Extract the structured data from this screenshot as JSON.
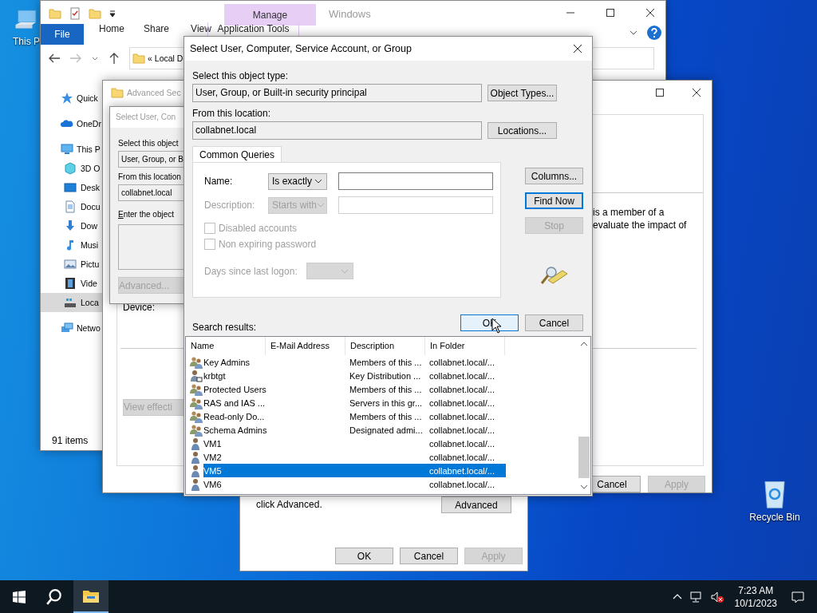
{
  "desktop_icons": [
    {
      "kind": "computer",
      "label": "This P"
    },
    {
      "kind": "recycle-bin",
      "label": "Recycle Bin"
    }
  ],
  "explorer": {
    "active": false,
    "title": "Windows",
    "context_tab": "Manage",
    "context_group": "Application Tools",
    "file_tab": "File",
    "ribbon_tabs": [
      "Home",
      "Share",
      "View"
    ],
    "address": {
      "prefix": "«",
      "path": "Local D"
    },
    "nav": [
      {
        "kind": "star",
        "label": "Quick",
        "selected": false
      },
      {
        "kind": "cloud",
        "label": "OneDr",
        "selected": false
      },
      {
        "kind": "pc",
        "label": "This P",
        "selected": false,
        "children": [
          {
            "kind": "cube",
            "label": "3D O",
            "selected": false
          },
          {
            "kind": "desktop",
            "label": "Desk",
            "selected": false
          },
          {
            "kind": "document",
            "label": "Docu",
            "selected": false
          },
          {
            "kind": "download",
            "label": "Dow",
            "selected": false
          },
          {
            "kind": "music",
            "label": "Musi",
            "selected": false
          },
          {
            "kind": "picture",
            "label": "Pictu",
            "selected": false
          },
          {
            "kind": "video",
            "label": "Vide",
            "selected": false
          },
          {
            "kind": "drive",
            "label": "Loca",
            "selected": true
          }
        ]
      },
      {
        "kind": "network",
        "label": "Netwo",
        "selected": false
      }
    ],
    "status": "91 items"
  },
  "security_window": {
    "active": false,
    "title": "Advanced Sec",
    "text_lines": [
      "is a member of a",
      "evaluate the impact of"
    ],
    "device_label": "Device:",
    "view_button": {
      "label": "View effecti",
      "disabled": true
    },
    "buttons": [
      {
        "label": "Cancel",
        "disabled": false
      },
      {
        "label": "Apply",
        "disabled": true
      }
    ]
  },
  "back_dialog": {
    "active": false,
    "title": "Select User, Con",
    "object_type_label": "Select this object",
    "object_type": "User, Group, or B",
    "location_label": "From this location",
    "location": "collabnet.local",
    "names_label": "Enter the object",
    "advanced_button": {
      "label": "Advanced...",
      "disabled": true
    }
  },
  "permission_dialog": {
    "text": "click Advanced.",
    "advanced_button": "Advanced",
    "buttons": [
      {
        "label": "OK",
        "disabled": false
      },
      {
        "label": "Cancel",
        "disabled": false
      },
      {
        "label": "Apply",
        "disabled": true
      }
    ]
  },
  "dialog": {
    "active": true,
    "title": "Select User, Computer, Service Account, or Group",
    "object_type_label": "Select this object type:",
    "object_type": "User, Group, or Built-in security principal",
    "object_types_button": "Object Types...",
    "location_label": "From this location:",
    "location": "collabnet.local",
    "locations_button": "Locations...",
    "query_tab": {
      "label": "Common Queries",
      "selected": true
    },
    "query_rows": [
      {
        "label": "Name:",
        "operator": "Is exactly",
        "disabled": false
      },
      {
        "label": "Description:",
        "operator": "Starts with",
        "disabled": true
      }
    ],
    "checkboxes": [
      {
        "label": "Disabled accounts",
        "checked": false,
        "disabled": true
      },
      {
        "label": "Non expiring password",
        "checked": false,
        "disabled": true
      }
    ],
    "days": {
      "label": "Days since last logon:",
      "disabled": true
    },
    "side_buttons": [
      {
        "label": "Columns...",
        "disabled": false,
        "focused": false
      },
      {
        "label": "Find Now",
        "disabled": false,
        "focused": true
      },
      {
        "label": "Stop",
        "disabled": true,
        "focused": false
      }
    ],
    "buttons": [
      {
        "label": "OK",
        "hovered": true
      },
      {
        "label": "Cancel",
        "hovered": false
      }
    ],
    "results_label": "Search results:",
    "columns": [
      "Name",
      "E-Mail Address",
      "Description",
      "In Folder"
    ],
    "rows": [
      {
        "kind": "group",
        "name": "Key Admins",
        "description": "Members of this ...",
        "folder": "collabnet.local/...",
        "selected": false
      },
      {
        "kind": "service",
        "name": "krbtgt",
        "description": "Key Distribution ...",
        "folder": "collabnet.local/...",
        "selected": false
      },
      {
        "kind": "group",
        "name": "Protected Users",
        "description": "Members of this ...",
        "folder": "collabnet.local/...",
        "selected": false
      },
      {
        "kind": "group",
        "name": "RAS and IAS ...",
        "description": "Servers in this gr...",
        "folder": "collabnet.local/...",
        "selected": false
      },
      {
        "kind": "group",
        "name": "Read-only Do...",
        "description": "Members of this ...",
        "folder": "collabnet.local/...",
        "selected": false
      },
      {
        "kind": "group",
        "name": "Schema Admins",
        "description": "Designated admi...",
        "folder": "collabnet.local/...",
        "selected": false
      },
      {
        "kind": "user",
        "name": "VM1",
        "folder": "collabnet.local/...",
        "selected": false
      },
      {
        "kind": "user",
        "name": "VM2",
        "folder": "collabnet.local/...",
        "selected": false
      },
      {
        "kind": "user",
        "name": "VM5",
        "folder": "collabnet.local/...",
        "selected": true
      },
      {
        "kind": "user",
        "name": "VM6",
        "folder": "collabnet.local/...",
        "selected": false
      }
    ]
  },
  "taskbar": {
    "apps": [
      {
        "kind": "explorer",
        "active": true
      }
    ],
    "volume_muted": true,
    "time": "7:23 AM",
    "date": "10/1/2023"
  }
}
